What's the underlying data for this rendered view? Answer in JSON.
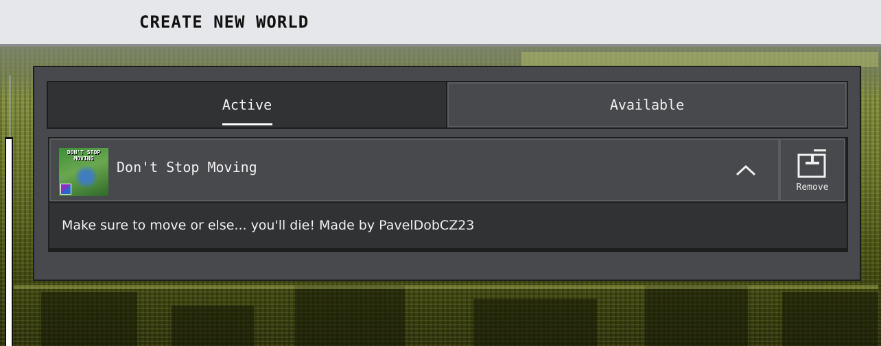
{
  "header": {
    "title": "CREATE NEW WORLD"
  },
  "tabs": [
    {
      "label": "Active",
      "selected": true
    },
    {
      "label": "Available",
      "selected": false
    }
  ],
  "pack": {
    "name": "Don't Stop Moving",
    "thumbnail_text": "DON'T STOP MOVING",
    "description": "Make sure to move or else... you'll die! Made by PavelDobCZ23",
    "expanded": true,
    "remove_label": "Remove"
  },
  "colors": {
    "header_bg": "#e6e7ea",
    "panel_bg": "#48494d",
    "tab_active_bg": "#313234",
    "text": "#f0f0f0"
  }
}
